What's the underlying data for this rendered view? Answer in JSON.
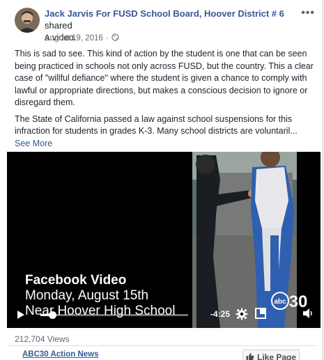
{
  "post": {
    "author": "Jack Jarvis For FUSD School Board, Hoover District # 6",
    "action_prefix": " shared",
    "action_line2": "a video.",
    "date": "August 19, 2016",
    "date_separator": " · ",
    "privacy_icon": "globe-icon",
    "more_icon": "more-options-icon",
    "paragraph1": "This is sad to see. This kind of action by the student is one that can be seen being practiced in schools not only across FUSD, but the country. This a clear case of \"willful defiance\" where the student is given a chance to comply with lawful or appropriate directions, but makes a conscious decision to ignore or disregard them.",
    "paragraph2": "The State of California passed a law against school suspensions for this infraction for students in grades K-3. Many school districts are voluntaril...",
    "see_more": "See More"
  },
  "video": {
    "title": "Facebook Video",
    "subtitle1": "Monday, August 15th",
    "subtitle2": "Near Hoover High School",
    "time_remaining": "-4:25",
    "progress_fraction": 0.08,
    "logo_text": "abc30",
    "icons": [
      "play-icon",
      "settings-icon",
      "fullscreen-icon",
      "volume-icon"
    ]
  },
  "footer": {
    "views": "212,704 Views",
    "page_name": "ABC30 Action News",
    "like_page": "Like Page"
  },
  "colors": {
    "link": "#365899",
    "text": "#1d2129",
    "meta": "#616770",
    "video_bg": "#000000"
  }
}
